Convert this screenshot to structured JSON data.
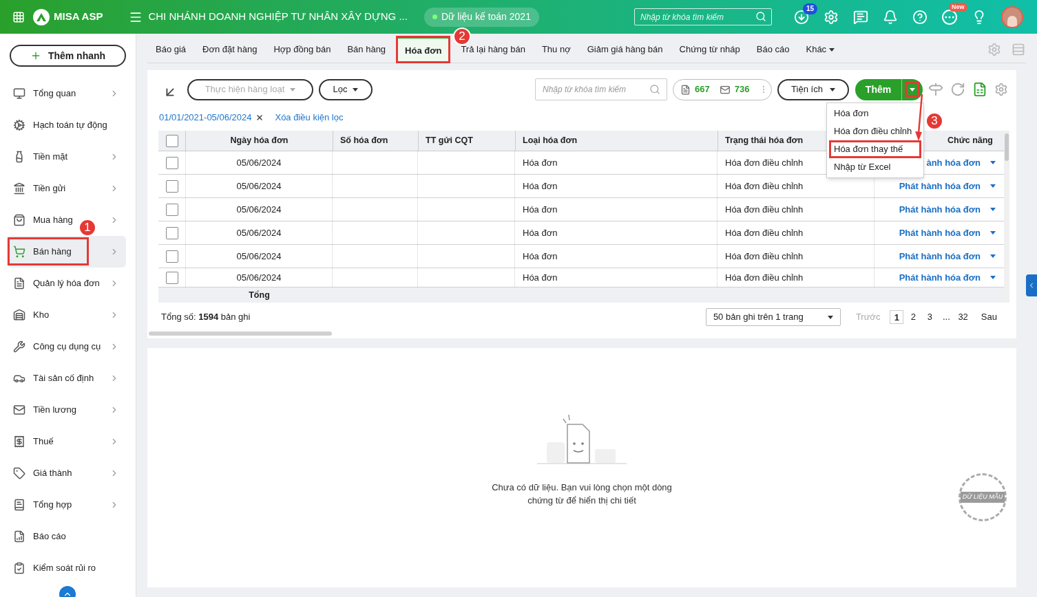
{
  "topbar": {
    "app_name": "MISA ASP",
    "company": "CHI NHÁNH DOANH NGHIỆP TƯ NHÂN XÂY DỰNG ...",
    "data_year": "Dữ liệu kế toán 2021",
    "search_placeholder": "Nhập từ khóa tìm kiếm",
    "download_count": "15",
    "new_badge": "New"
  },
  "sidebar": {
    "quick_add": "Thêm nhanh",
    "annotation": "1",
    "items": [
      {
        "label": "Tổng quan",
        "selected": false,
        "arrow": true
      },
      {
        "label": "Hạch toán tự động",
        "selected": false,
        "arrow": false
      },
      {
        "label": "Tiền mặt",
        "selected": false,
        "arrow": true
      },
      {
        "label": "Tiền gửi",
        "selected": false,
        "arrow": true
      },
      {
        "label": "Mua hàng",
        "selected": false,
        "arrow": true
      },
      {
        "label": "Bán hàng",
        "selected": true,
        "arrow": true
      },
      {
        "label": "Quản lý hóa đơn",
        "selected": false,
        "arrow": true
      },
      {
        "label": "Kho",
        "selected": false,
        "arrow": true
      },
      {
        "label": "Công cụ dụng cụ",
        "selected": false,
        "arrow": true
      },
      {
        "label": "Tài sản cố định",
        "selected": false,
        "arrow": true
      },
      {
        "label": "Tiền lương",
        "selected": false,
        "arrow": true
      },
      {
        "label": "Thuế",
        "selected": false,
        "arrow": true
      },
      {
        "label": "Giá thành",
        "selected": false,
        "arrow": true
      },
      {
        "label": "Tổng hợp",
        "selected": false,
        "arrow": true
      },
      {
        "label": "Báo cáo",
        "selected": false,
        "arrow": false
      },
      {
        "label": "Kiểm soát rủi ro",
        "selected": false,
        "arrow": false
      }
    ]
  },
  "tabs": {
    "annotation": "2",
    "more": "Khác",
    "items": [
      {
        "label": "Báo giá",
        "selected": false
      },
      {
        "label": "Đơn đặt hàng",
        "selected": false
      },
      {
        "label": "Hợp đồng bán",
        "selected": false
      },
      {
        "label": "Bán hàng",
        "selected": false
      },
      {
        "label": "Hóa đơn",
        "selected": true
      },
      {
        "label": "Trả lại hàng bán",
        "selected": false
      },
      {
        "label": "Thu nợ",
        "selected": false
      },
      {
        "label": "Giảm giá hàng bán",
        "selected": false
      },
      {
        "label": "Chứng từ nháp",
        "selected": false
      },
      {
        "label": "Báo cáo",
        "selected": false
      }
    ]
  },
  "toolbar": {
    "bulk_action": "Thực hiện hàng loạt",
    "bulk_disabled": true,
    "filter": "Lọc",
    "search_placeholder": "Nhập từ khóa tìm kiếm",
    "doc_count": "667",
    "mail_count": "736",
    "utilities": "Tiện ích",
    "add": "Thêm",
    "annotation": "3"
  },
  "filter_bar": {
    "date_range": "01/01/2021-05/06/2024",
    "clear": "Xóa điều kiện lọc"
  },
  "add_menu": [
    {
      "label": "Hóa đơn",
      "highlighted": false
    },
    {
      "label": "Hóa đơn điều chỉnh",
      "highlighted": false
    },
    {
      "label": "Hóa đơn thay thế",
      "highlighted": true
    },
    {
      "label": "Nhập từ Excel",
      "highlighted": false
    }
  ],
  "table": {
    "select_all_checked": false,
    "columns": [
      "Ngày hóa đơn",
      "Số hóa đơn",
      "TT gửi CQT",
      "Loại hóa đơn",
      "Trạng thái hóa đơn",
      "Chức năng"
    ],
    "rows": [
      {
        "checked": false,
        "date": "05/06/2024",
        "type": "Hóa đơn",
        "status": "Hóa đơn điều chỉnh",
        "action": "ành hóa đơn"
      },
      {
        "checked": false,
        "date": "05/06/2024",
        "type": "Hóa đơn",
        "status": "Hóa đơn điều chỉnh",
        "action": "Phát hành hóa đơn"
      },
      {
        "checked": false,
        "date": "05/06/2024",
        "type": "Hóa đơn",
        "status": "Hóa đơn điều chỉnh",
        "action": "Phát hành hóa đơn"
      },
      {
        "checked": false,
        "date": "05/06/2024",
        "type": "Hóa đơn",
        "status": "Hóa đơn điều chỉnh",
        "action": "Phát hành hóa đơn"
      },
      {
        "checked": false,
        "date": "05/06/2024",
        "type": "Hóa đơn",
        "status": "Hóa đơn điều chỉnh",
        "action": "Phát hành hóa đơn"
      },
      {
        "checked": false,
        "date": "05/06/2024",
        "type": "Hóa đơn",
        "status": "Hóa đơn điều chỉnh",
        "action": "Phát hành hóa đơn"
      }
    ],
    "total_label": "Tổng"
  },
  "pagination": {
    "total": "Tổng số: **1594** bản ghi",
    "page_size": "50 bản ghi trên 1 trang",
    "prev": "Trước",
    "next": "Sau",
    "pages": [
      {
        "label": "1",
        "selected": true
      },
      {
        "label": "2",
        "selected": false
      },
      {
        "label": "3",
        "selected": false
      },
      {
        "label": "...",
        "selected": false
      },
      {
        "label": "32",
        "selected": false
      }
    ]
  },
  "detail": {
    "empty_message": "Chưa có dữ liệu. Bạn vui lòng chọn một dòng chứng từ để hiển thị chi tiết",
    "stamp": "DỮ LIỆU MẪU"
  }
}
